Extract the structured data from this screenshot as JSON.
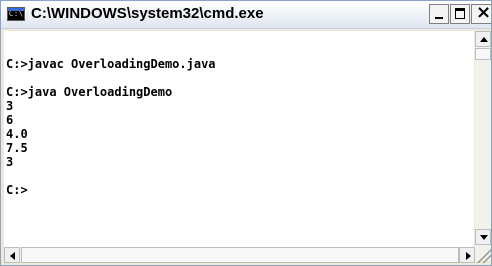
{
  "window": {
    "title": "C:\\WINDOWS\\system32\\cmd.exe",
    "icon": "cmd-icon",
    "icon_text": "C:\\"
  },
  "controls": {
    "minimize": "minimize-icon",
    "maximize": "maximize-icon",
    "close": "close-icon"
  },
  "console": {
    "lines": [
      "C:>javac OverloadingDemo.java",
      "",
      "C:>java OverloadingDemo",
      "3",
      "6",
      "4.0",
      "7.5",
      "3",
      "",
      "C:>"
    ]
  },
  "colors": {
    "console_background": "#ffffff",
    "console_text": "#000000",
    "titlebar": "#dfe6f0"
  }
}
